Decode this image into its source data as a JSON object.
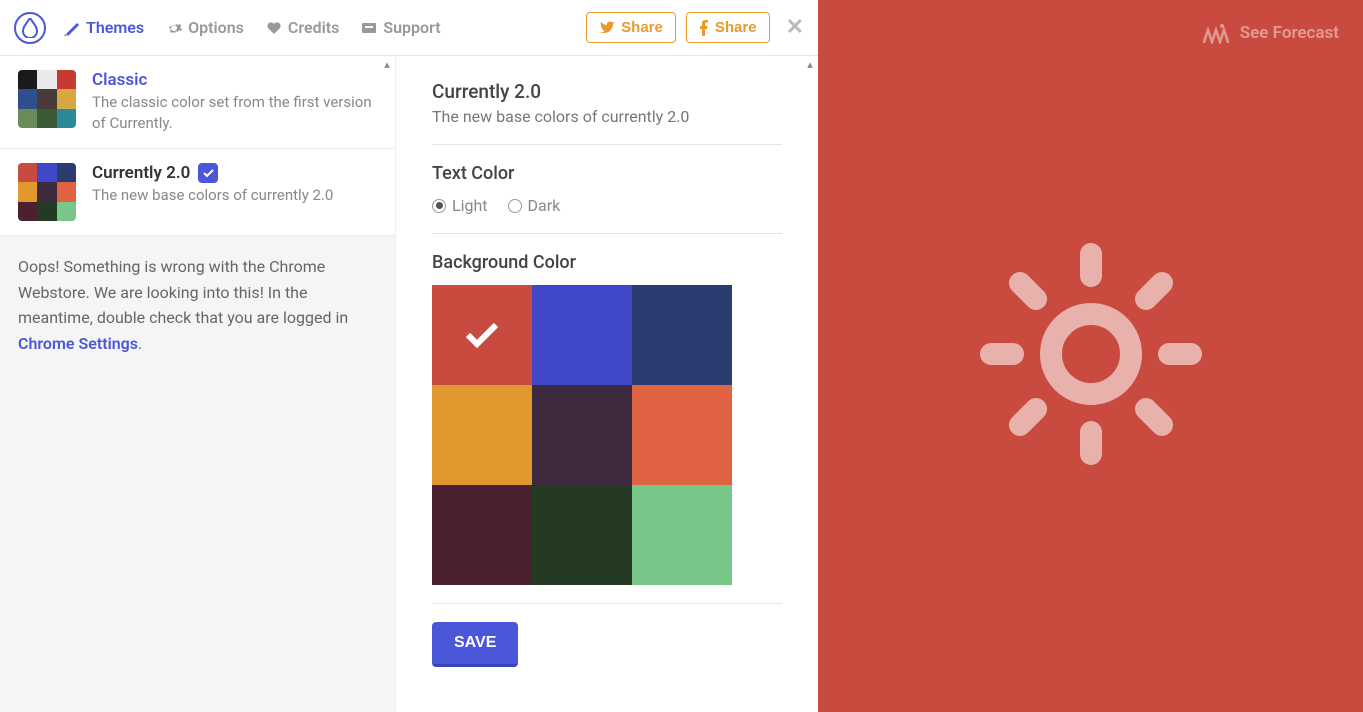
{
  "nav": {
    "themes": "Themes",
    "options": "Options",
    "credits": "Credits",
    "support": "Support"
  },
  "share": {
    "twitter": "Share",
    "facebook": "Share"
  },
  "themes": [
    {
      "title": "Classic",
      "desc": "The classic color set from the first version of Currently.",
      "selected": false,
      "colors": [
        "#1a1a1a",
        "#eaeaea",
        "#c53a32",
        "#2f4e8d",
        "#4a3a3a",
        "#d7a741",
        "#6b8b5a",
        "#3a5a3a",
        "#2a8a99"
      ]
    },
    {
      "title": "Currently 2.0",
      "desc": "The new base colors of currently 2.0",
      "selected": true,
      "colors": [
        "#c94a3f",
        "#4047c8",
        "#2b3d70",
        "#e0982f",
        "#3e2a3e",
        "#df6243",
        "#4a2130",
        "#243a23",
        "#79c689"
      ]
    }
  ],
  "error": {
    "text": "Oops! Something is wrong with the Chrome Webstore. We are looking into this! In the meantime, double check that you are logged in ",
    "link": "Chrome Settings"
  },
  "detail": {
    "title": "Currently 2.0",
    "desc": "The new base colors of currently 2.0",
    "text_color_label": "Text Color",
    "text_color_options": [
      "Light",
      "Dark"
    ],
    "text_color_selected": "Light",
    "bg_label": "Background Color",
    "bg_colors": [
      "#c94a3f",
      "#4047c8",
      "#2b3d70",
      "#e0982f",
      "#3e2a3e",
      "#df6243",
      "#4a2130",
      "#243a23",
      "#79c689"
    ],
    "bg_selected": 0,
    "save": "SAVE"
  },
  "forecast": "See Forecast"
}
